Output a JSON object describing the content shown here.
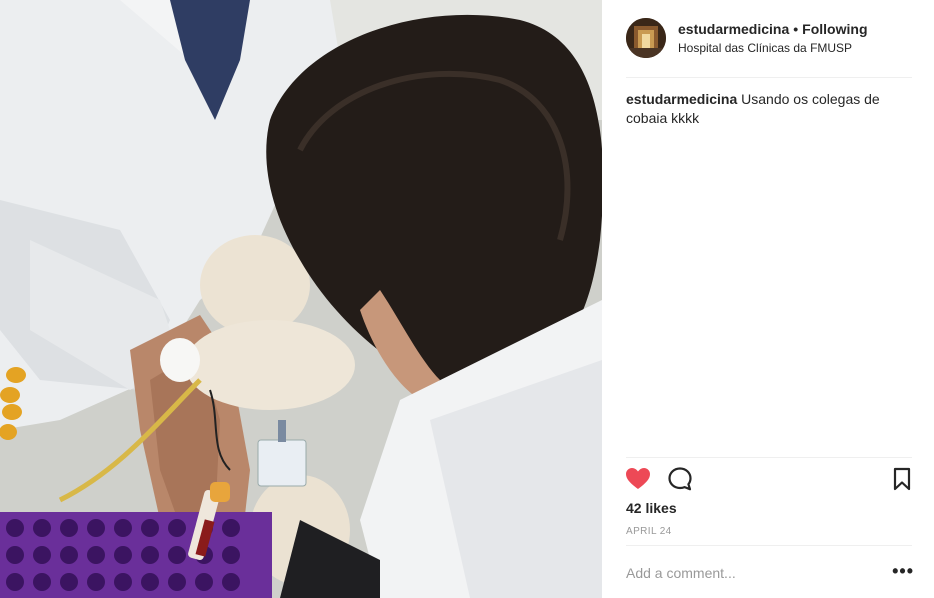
{
  "post": {
    "photo_alt": "Medical students drawing blood in a lab"
  },
  "header": {
    "username": "estudarmedicina",
    "separator": "•",
    "follow_status": "Following",
    "location": "Hospital das Clínicas da FMUSP"
  },
  "caption": {
    "username": "estudarmedicina",
    "text": "Usando os colegas de cobaia kkkk"
  },
  "actions": {
    "like_icon": "heart-filled-icon",
    "comment_icon": "comment-bubble-icon",
    "save_icon": "bookmark-icon",
    "like_color": "#ed4956"
  },
  "likes": "42 likes",
  "date": "APRIL 24",
  "comment": {
    "placeholder": "Add a comment...",
    "more_label": "•••"
  }
}
